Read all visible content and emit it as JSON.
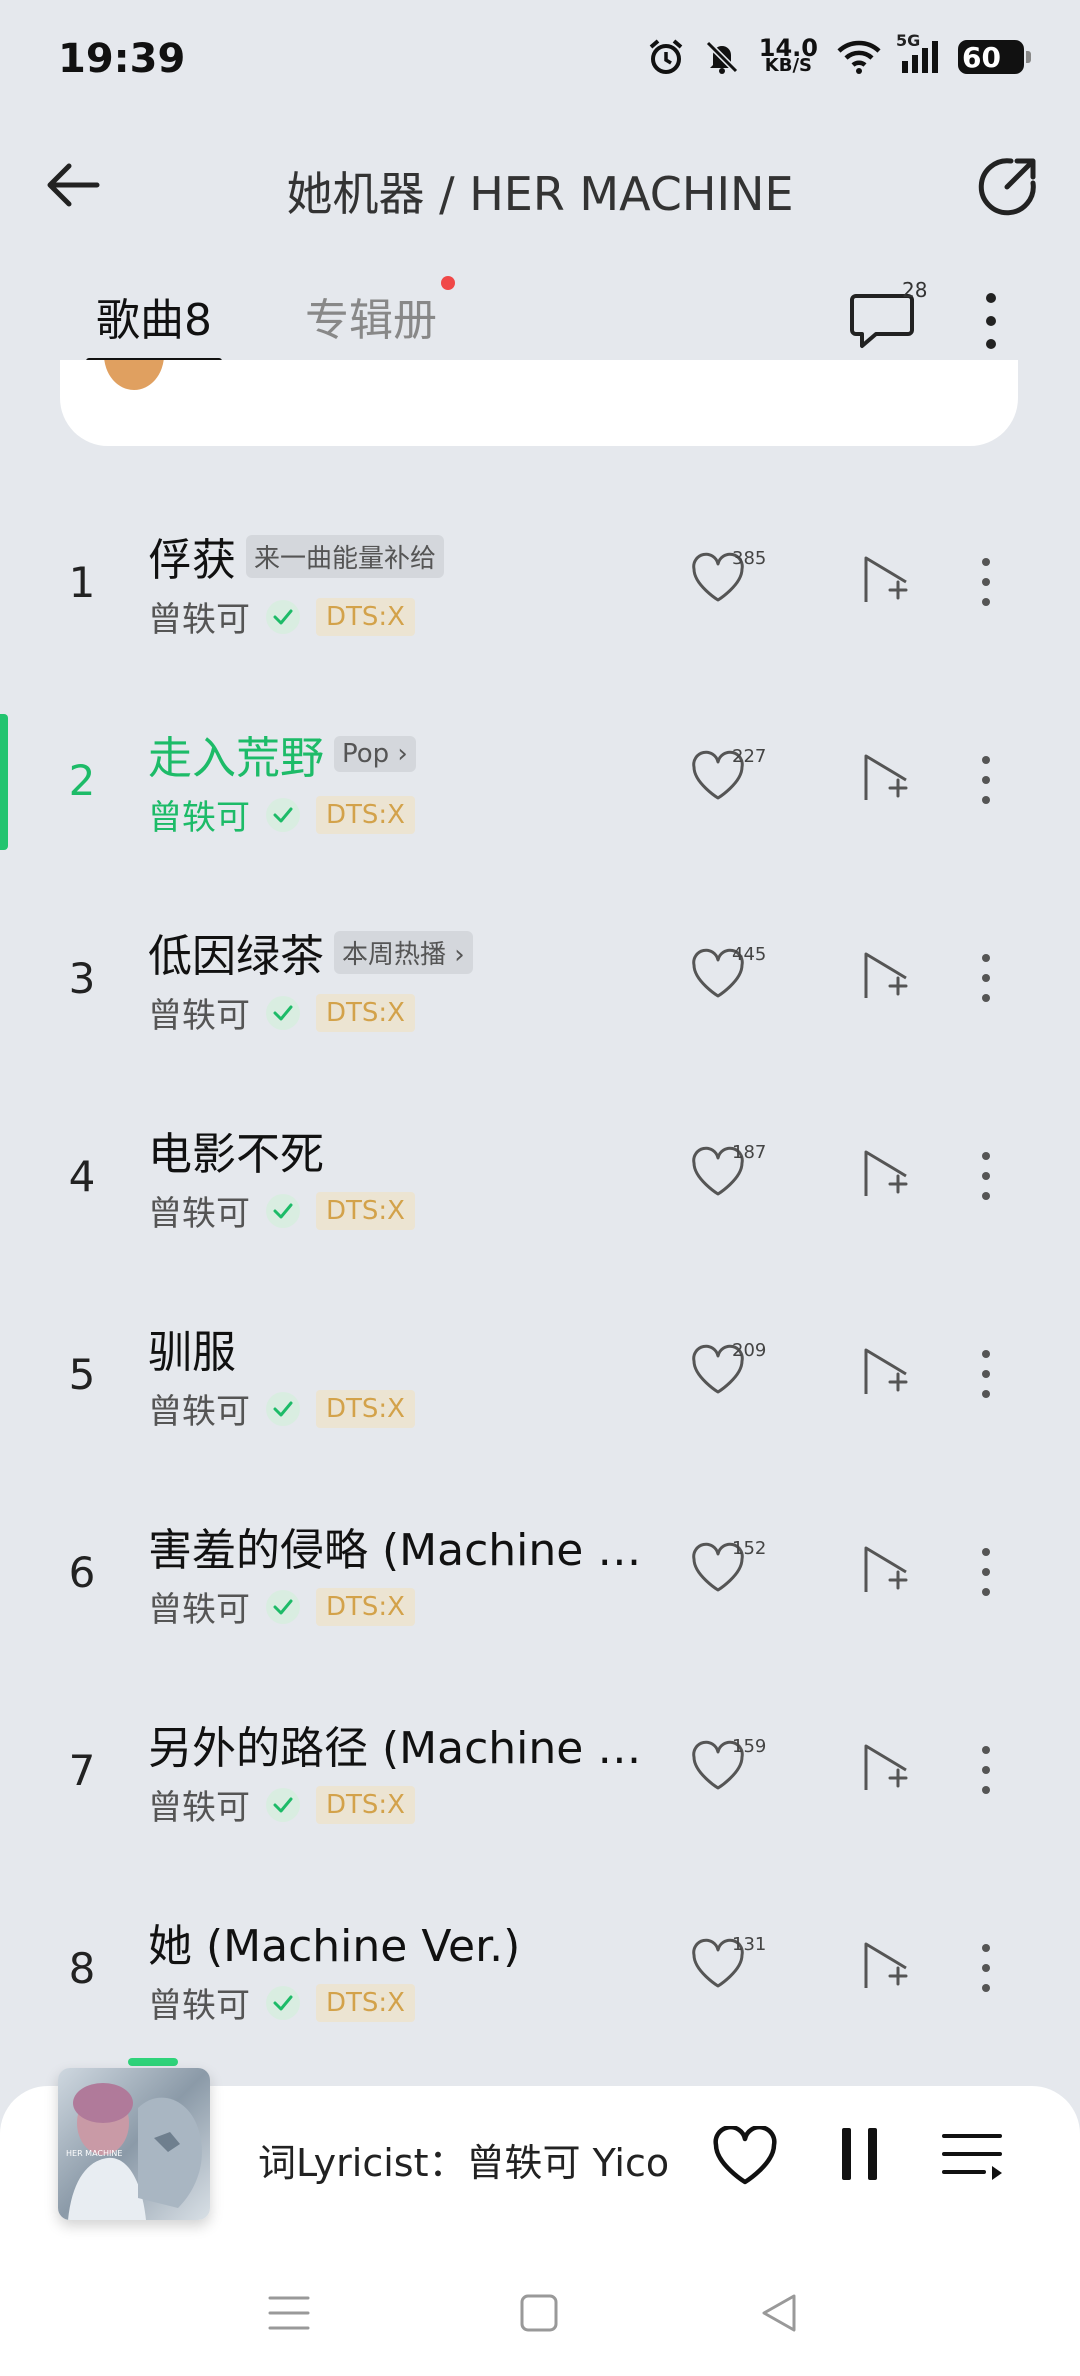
{
  "status_bar": {
    "time": "19:39",
    "net_speed_value": "14.0",
    "net_speed_unit": "KB/S",
    "network": "5G",
    "battery": "60",
    "icons": [
      "alarm-icon",
      "mute-icon",
      "wifi-icon",
      "signal-icon",
      "battery-icon"
    ]
  },
  "header": {
    "title": "她机器 / HER MACHINE",
    "back_icon": "arrow-left-icon",
    "share_icon": "share-icon"
  },
  "tabs": {
    "songs_label": "歌曲8",
    "albums_label": "专辑册",
    "comment_count": "28"
  },
  "songs": [
    {
      "num": "1",
      "title": "俘获",
      "tag": "来一曲能量补给",
      "artist": "曾轶可",
      "badge": "DTS:X",
      "likes": "385"
    },
    {
      "num": "2",
      "title": "走入荒野",
      "tag": "Pop",
      "artist": "曾轶可",
      "badge": "DTS:X",
      "likes": "227"
    },
    {
      "num": "3",
      "title": "低因绿茶",
      "tag": "本周热播",
      "artist": "曾轶可",
      "badge": "DTS:X",
      "likes": "445"
    },
    {
      "num": "4",
      "title": "电影不死",
      "tag": "",
      "artist": "曾轶可",
      "badge": "DTS:X",
      "likes": "187"
    },
    {
      "num": "5",
      "title": "驯服",
      "tag": "",
      "artist": "曾轶可",
      "badge": "DTS:X",
      "likes": "209"
    },
    {
      "num": "6",
      "title": "害羞的侵略 (Machine V...",
      "tag": "",
      "artist": "曾轶可",
      "badge": "DTS:X",
      "likes": "152"
    },
    {
      "num": "7",
      "title": "另外的路径 (Machine V...",
      "tag": "",
      "artist": "曾轶可",
      "badge": "DTS:X",
      "likes": "159"
    },
    {
      "num": "8",
      "title": "她 (Machine Ver.)",
      "tag": "",
      "artist": "曾轶可",
      "badge": "DTS:X",
      "likes": "131"
    }
  ],
  "player": {
    "lyric": "词Lyricist：曾轶可 Yico",
    "cover_text": "HER MACHINE"
  },
  "colors": {
    "accent": "#1dbb68",
    "background": "#e5e8ed",
    "dts": "#d3a24a",
    "red_dot": "#f04848"
  }
}
